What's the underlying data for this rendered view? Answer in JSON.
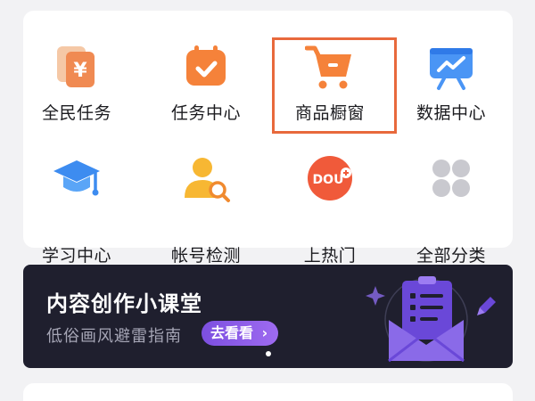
{
  "tools": [
    {
      "label": "全民任务",
      "icon": "yuan-cards-icon"
    },
    {
      "label": "任务中心",
      "icon": "calendar-check-icon"
    },
    {
      "label": "商品橱窗",
      "icon": "shopping-cart-icon"
    },
    {
      "label": "数据中心",
      "icon": "presentation-chart-icon"
    },
    {
      "label": "学习中心",
      "icon": "graduation-cap-icon"
    },
    {
      "label": "帐号检测",
      "icon": "user-search-icon"
    },
    {
      "label": "上热门",
      "icon": "dou-plus-icon"
    },
    {
      "label": "全部分类",
      "icon": "grid-dots-icon"
    }
  ],
  "highlighted_tool": "商品橱窗",
  "banner": {
    "title": "内容创作小课堂",
    "subtitle": "低俗画风避雷指南",
    "button_label": "去看看",
    "button_arrow": "›",
    "dou_logo_text": "DOU"
  },
  "colors": {
    "accent_orange": "#f0782f",
    "highlight_border": "#e8693c",
    "banner_bg": "#1f1f2e",
    "button_purple": "#8a5ce8"
  }
}
